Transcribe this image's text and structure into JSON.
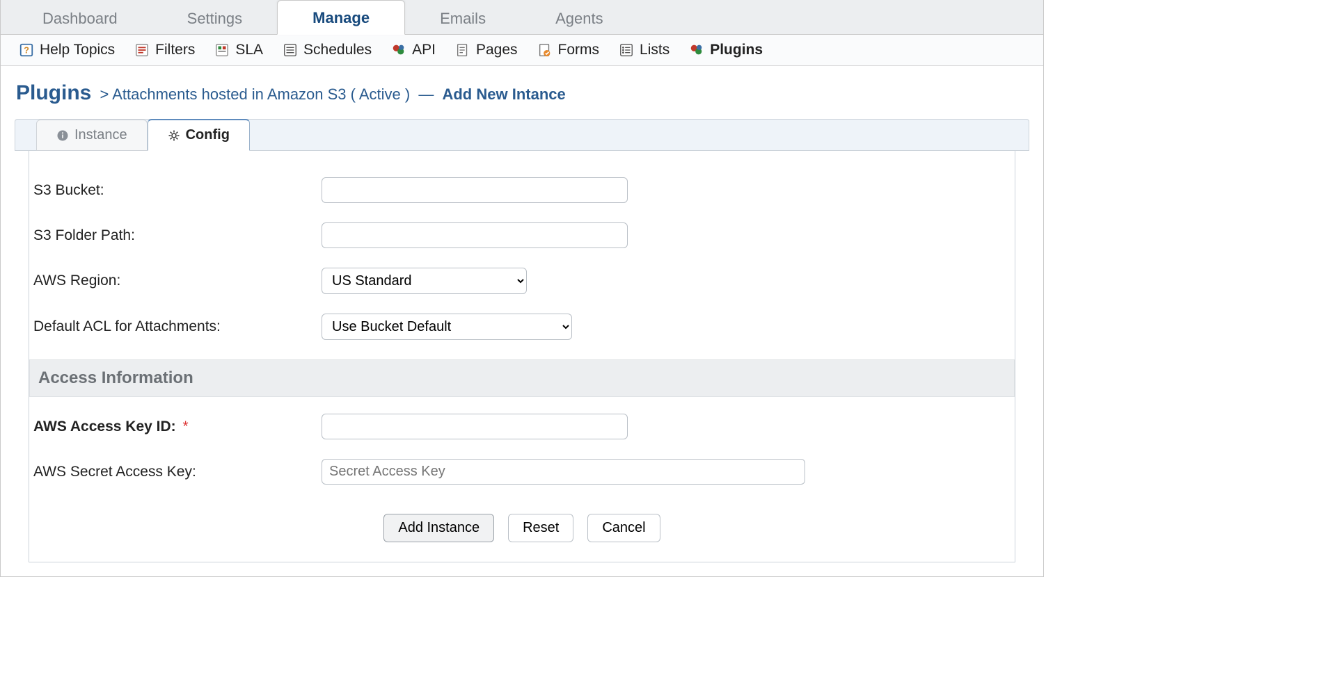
{
  "topnav": {
    "items": [
      {
        "label": "Dashboard",
        "active": false
      },
      {
        "label": "Settings",
        "active": false
      },
      {
        "label": "Manage",
        "active": true
      },
      {
        "label": "Emails",
        "active": false
      },
      {
        "label": "Agents",
        "active": false
      }
    ]
  },
  "subnav": {
    "items": [
      {
        "label": "Help Topics",
        "icon": "help-topics-icon",
        "active": false
      },
      {
        "label": "Filters",
        "icon": "filters-icon",
        "active": false
      },
      {
        "label": "SLA",
        "icon": "sla-icon",
        "active": false
      },
      {
        "label": "Schedules",
        "icon": "schedules-icon",
        "active": false
      },
      {
        "label": "API",
        "icon": "api-icon",
        "active": false
      },
      {
        "label": "Pages",
        "icon": "pages-icon",
        "active": false
      },
      {
        "label": "Forms",
        "icon": "forms-icon",
        "active": false
      },
      {
        "label": "Lists",
        "icon": "lists-icon",
        "active": false
      },
      {
        "label": "Plugins",
        "icon": "plugins-icon",
        "active": true
      }
    ]
  },
  "breadcrumb": {
    "root": "Plugins",
    "sep": ">",
    "plugin_link": "Attachments hosted in Amazon S3 ( Active )",
    "dash": "—",
    "current": "Add New Intance"
  },
  "content_tabs": {
    "instance": {
      "label": "Instance",
      "icon": "info-icon",
      "active": false
    },
    "config": {
      "label": "Config",
      "icon": "gear-icon",
      "active": true
    }
  },
  "form": {
    "s3_bucket": {
      "label": "S3 Bucket:",
      "value": ""
    },
    "s3_folder": {
      "label": "S3 Folder Path:",
      "value": ""
    },
    "aws_region": {
      "label": "AWS Region:",
      "value": "US Standard"
    },
    "default_acl": {
      "label": "Default ACL for Attachments:",
      "value": "Use Bucket Default"
    },
    "section_access_info": "Access Information",
    "access_key_id": {
      "label": "AWS Access Key ID:",
      "required": "*",
      "value": ""
    },
    "secret_key": {
      "label": "AWS Secret Access Key:",
      "placeholder": "Secret Access Key",
      "value": ""
    }
  },
  "actions": {
    "submit": "Add Instance",
    "reset": "Reset",
    "cancel": "Cancel"
  }
}
